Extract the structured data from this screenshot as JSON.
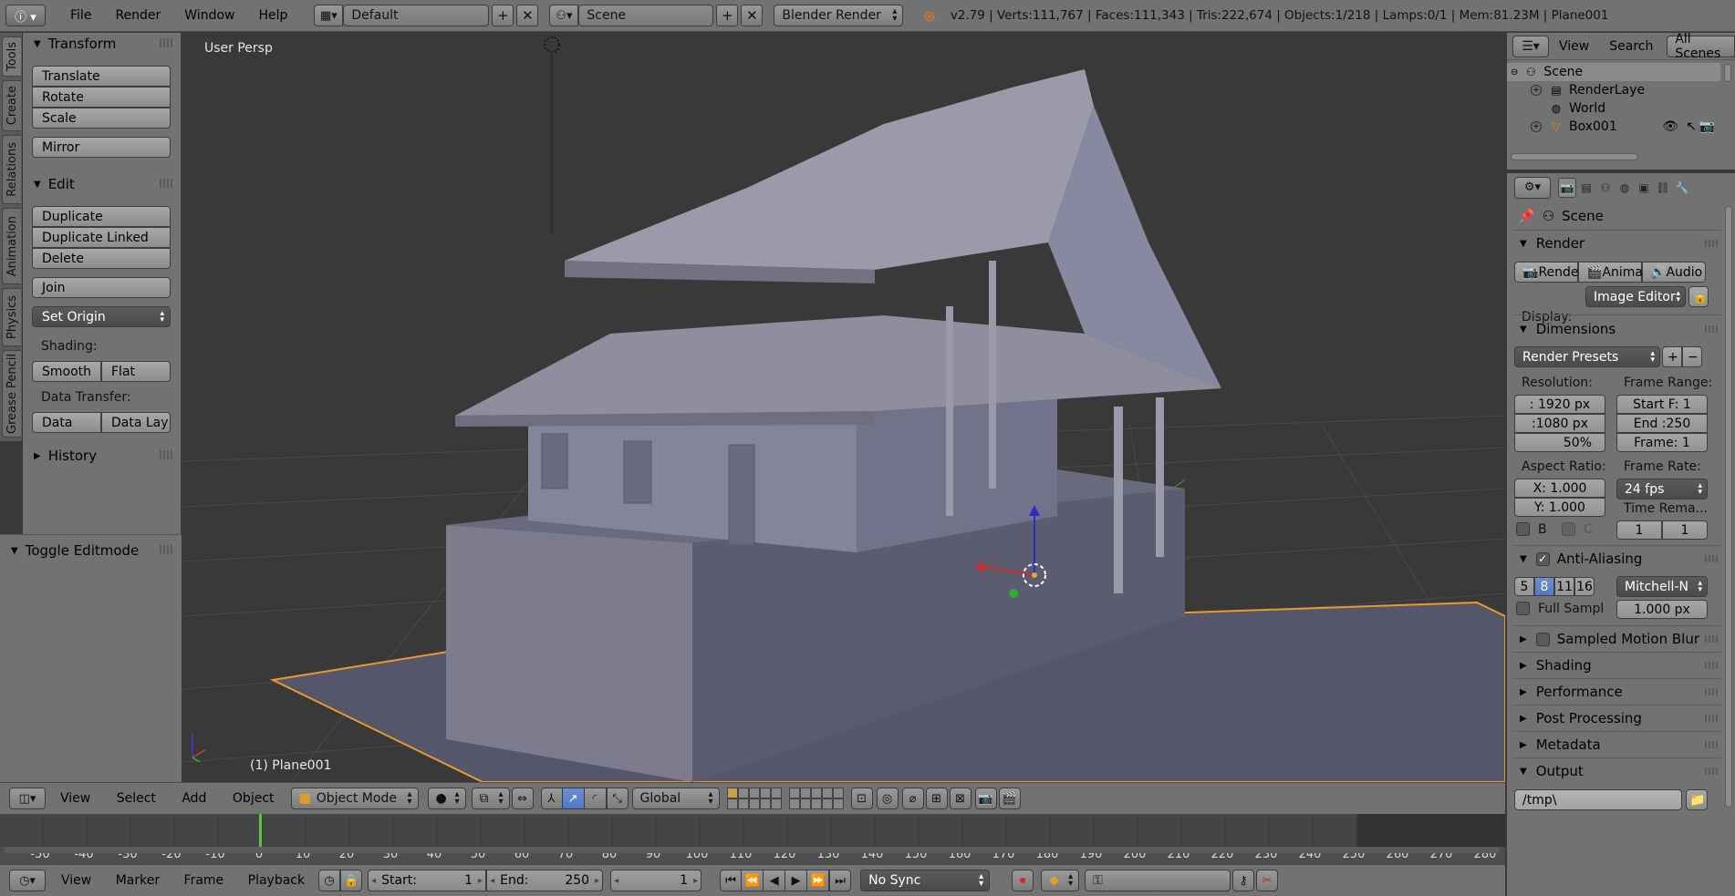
{
  "top_bar": {
    "menus": [
      "File",
      "Render",
      "Window",
      "Help"
    ],
    "layout": "Default",
    "scene": "Scene",
    "engine": "Blender Render",
    "stats": "v2.79 | Verts:111,767 | Faces:111,343 | Tris:222,674 | Objects:1/218 | Lamps:0/1 | Mem:81.23M | Plane001"
  },
  "tool_tabs": [
    "Tools",
    "Create",
    "Relations",
    "Animation",
    "Physics",
    "Grease Pencil"
  ],
  "tool_shelf": {
    "transform_header": "Transform",
    "translate": "Translate",
    "rotate": "Rotate",
    "scale": "Scale",
    "mirror": "Mirror",
    "edit_header": "Edit",
    "duplicate": "Duplicate",
    "duplicate_linked": "Duplicate Linked",
    "delete": "Delete",
    "join": "Join",
    "set_origin": "Set Origin",
    "shading_label": "Shading:",
    "smooth": "Smooth",
    "flat": "Flat",
    "data_transfer_label": "Data Transfer:",
    "data": "Data",
    "data_lay": "Data Lay",
    "history_header": "History",
    "operator_header": "Toggle Editmode"
  },
  "viewport": {
    "view_label": "User Persp",
    "object_label": "(1) Plane001",
    "colors": {
      "background": "#393939",
      "grid": "#4a4a4a",
      "selected_outline": "#f0a030",
      "x_axis": "#c83a3a",
      "y_axis": "#4c9a3a",
      "model": "#8e8e9a"
    }
  },
  "viewport_header": {
    "menus": [
      "View",
      "Select",
      "Add",
      "Object"
    ],
    "mode": "Object Mode",
    "orientation": "Global"
  },
  "timeline": {
    "ticks": [
      "-50",
      "-40",
      "-30",
      "-20",
      "-10",
      "0",
      "10",
      "20",
      "30",
      "40",
      "50",
      "60",
      "70",
      "80",
      "90",
      "100",
      "110",
      "120",
      "130",
      "140",
      "150",
      "160",
      "170",
      "180",
      "190",
      "200",
      "210",
      "220",
      "230",
      "240",
      "250",
      "260",
      "270",
      "280"
    ],
    "current_frame_value": 1
  },
  "timeline_header": {
    "menus": [
      "View",
      "Marker",
      "Frame",
      "Playback"
    ],
    "start_label": "Start:",
    "start_value": "1",
    "end_label": "End:",
    "end_value": "250",
    "current_frame": "1",
    "sync": "No Sync"
  },
  "outliner": {
    "menus": [
      "View",
      "Search"
    ],
    "filter": "All Scenes",
    "rows": [
      "Scene",
      "RenderLaye",
      "World",
      "Box001"
    ]
  },
  "properties": {
    "context": "Scene",
    "render_header": "Render",
    "render_btn": "Render",
    "animation_btn": "Animat",
    "audio_btn": "Audio",
    "display_label": "Display:",
    "display_value": "Image Editor",
    "dimensions_header": "Dimensions",
    "render_presets": "Render Presets",
    "resolution_label": "Resolution:",
    "res_x": ": 1920 px",
    "res_y": ":1080 px",
    "res_pct": "50%",
    "frame_range_label": "Frame Range:",
    "start_frame": "Start F: 1",
    "end_frame": "End :250",
    "frame": "Frame: 1",
    "aspect_label": "Aspect Ratio:",
    "aspect_x": "X:  1.000",
    "aspect_y": "Y:  1.000",
    "frame_rate_label": "Frame Rate:",
    "fps": "24 fps",
    "time_remap_label": "Time Rema...",
    "time_old": "1",
    "time_new": "1",
    "border_label": "B",
    "crop_label": "C",
    "aa_header": "Anti-Aliasing",
    "aa_samples": [
      "5",
      "8",
      "11",
      "16"
    ],
    "aa_filter": "Mitchell-N",
    "full_sample": "Full Sampl",
    "filter_size": "1.000 px",
    "sampled_motion_blur": "Sampled Motion Blur",
    "shading": "Shading",
    "performance": "Performance",
    "post_processing": "Post Processing",
    "metadata": "Metadata",
    "output_header": "Output",
    "output_path": "/tmp\\"
  }
}
